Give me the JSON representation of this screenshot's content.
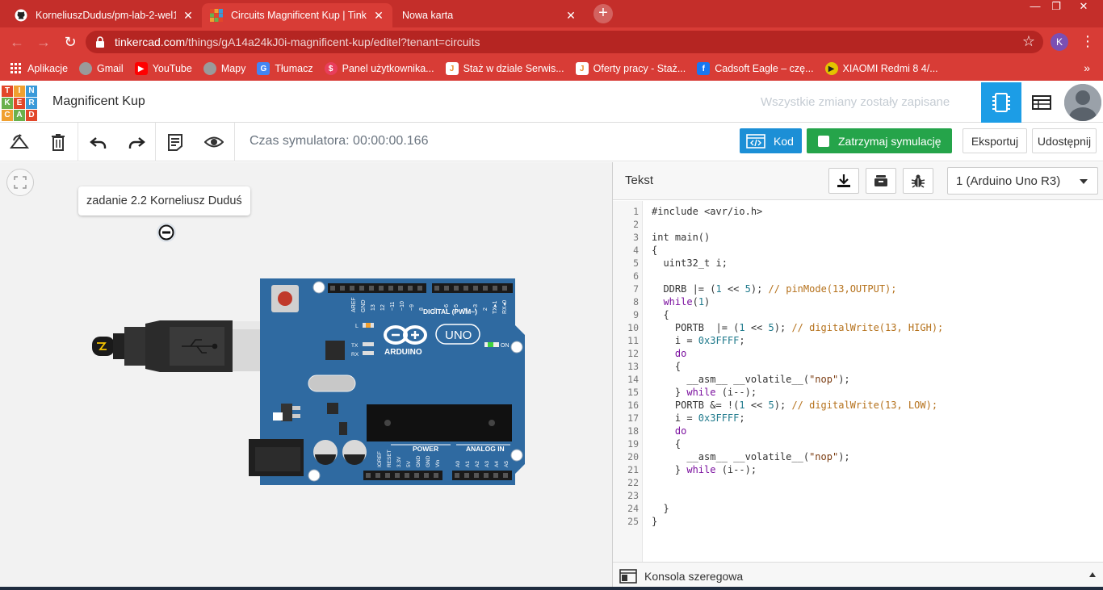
{
  "browser": {
    "tabs": [
      {
        "title": "KorneliuszDudus/pm-lab-2-wel1",
        "favicon": "github-icon"
      },
      {
        "title": "Circuits Magnificent Kup | Tinkercad",
        "favicon": "tinkercad-icon"
      },
      {
        "title": "Nowa karta",
        "favicon": ""
      }
    ],
    "new_tab": "+",
    "url_host": "tinkercad.com",
    "url_path": "/things/gA14a24kJ0i-magnificent-kup/editel?tenant=circuits",
    "profile_initial": "K",
    "bookmarks": [
      {
        "label": "Aplikacje",
        "icon": "apps-grid-icon",
        "color": "#d83c36"
      },
      {
        "label": "Gmail",
        "icon": "globe-icon",
        "color": "#9a9a9a"
      },
      {
        "label": "YouTube",
        "icon": "youtube-icon",
        "color": "#ff0000"
      },
      {
        "label": "Mapy",
        "icon": "globe-icon",
        "color": "#9a9a9a"
      },
      {
        "label": "Tłumacz",
        "icon": "translate-icon",
        "color": "#4285f4"
      },
      {
        "label": "Panel użytkownika...",
        "icon": "panel-icon",
        "color": "#e83e5b"
      },
      {
        "label": "Staż w dziale Serwis...",
        "icon": "job-icon",
        "color": "#e8e8e8"
      },
      {
        "label": "Oferty pracy - Staż...",
        "icon": "job-icon",
        "color": "#e8e8e8"
      },
      {
        "label": "Cadsoft Eagle – czę...",
        "icon": "facebook-icon",
        "color": "#1877f2"
      },
      {
        "label": "XIAOMI Redmi 8 4/...",
        "icon": "play-icon",
        "color": "#e3c400"
      }
    ],
    "bookmarks_more": "»"
  },
  "header": {
    "logo_letters": [
      "T",
      "I",
      "N",
      "K",
      "E",
      "R",
      "C",
      "A",
      "D"
    ],
    "logo_colors": [
      "#e2472a",
      "#f0a030",
      "#3a9ad9",
      "#6ab04c",
      "#e2472a",
      "#3a9ad9",
      "#f0a030",
      "#6ab04c",
      "#e2472a"
    ],
    "project_title": "Magnificent Kup",
    "save_status": "Wszystkie zmiany zostały zapisane"
  },
  "toolbar": {
    "sim_time": "Czas symulatora: 00:00:00.166",
    "code_label": "Kod",
    "stop_label": "Zatrzymaj symulację",
    "export_label": "Eksportuj",
    "share_label": "Udostępnij"
  },
  "canvas": {
    "note_text": "zadanie 2.2 Korneliusz Duduś",
    "board": {
      "brand": "ARDUINO",
      "model": "UNO",
      "digital_label": "DIGITAL (PWM~)",
      "power_label": "POWER",
      "analog_label": "ANALOG IN",
      "on_label": "ON",
      "tx_label": "TX",
      "rx_label": "RX",
      "l_label": "L",
      "aref_label": "AREF",
      "gnd_label": "GND",
      "digital_pins": [
        "13",
        "12",
        "~11",
        "~10",
        "~9",
        "8",
        "7",
        "~6",
        "~5",
        "4",
        "~3",
        "2",
        "TX▸1",
        "RX◂0"
      ],
      "power_pins": [
        "IOREF",
        "RESET",
        "3.3V",
        "5V",
        "GND",
        "GND",
        "Vin"
      ],
      "analog_pins": [
        "A0",
        "A1",
        "A2",
        "A3",
        "A4",
        "A5"
      ]
    }
  },
  "code_panel": {
    "title": "Tekst",
    "device_select": "1 (Arduino Uno R3)",
    "console_label": "Konsola szeregowa",
    "code_lines": [
      "#include <avr/io.h>",
      "",
      "int main()",
      "{",
      "  uint32_t i;",
      "",
      "  DDRB |= (1 << 5); // pinMode(13,OUTPUT);",
      "  while(1)",
      "  {",
      "    PORTB  |= (1 << 5); // digitalWrite(13, HIGH);",
      "    i = 0x3FFFF;",
      "    do",
      "    {",
      "      __asm__ __volatile__(\"nop\");",
      "    } while (i--);",
      "    PORTB &= !(1 << 5); // digitalWrite(13, LOW);",
      "    i = 0x3FFFF;",
      "    do",
      "    {",
      "      __asm__ __volatile__(\"nop\");",
      "    } while (i--);",
      "",
      "",
      "  }",
      "}"
    ]
  }
}
